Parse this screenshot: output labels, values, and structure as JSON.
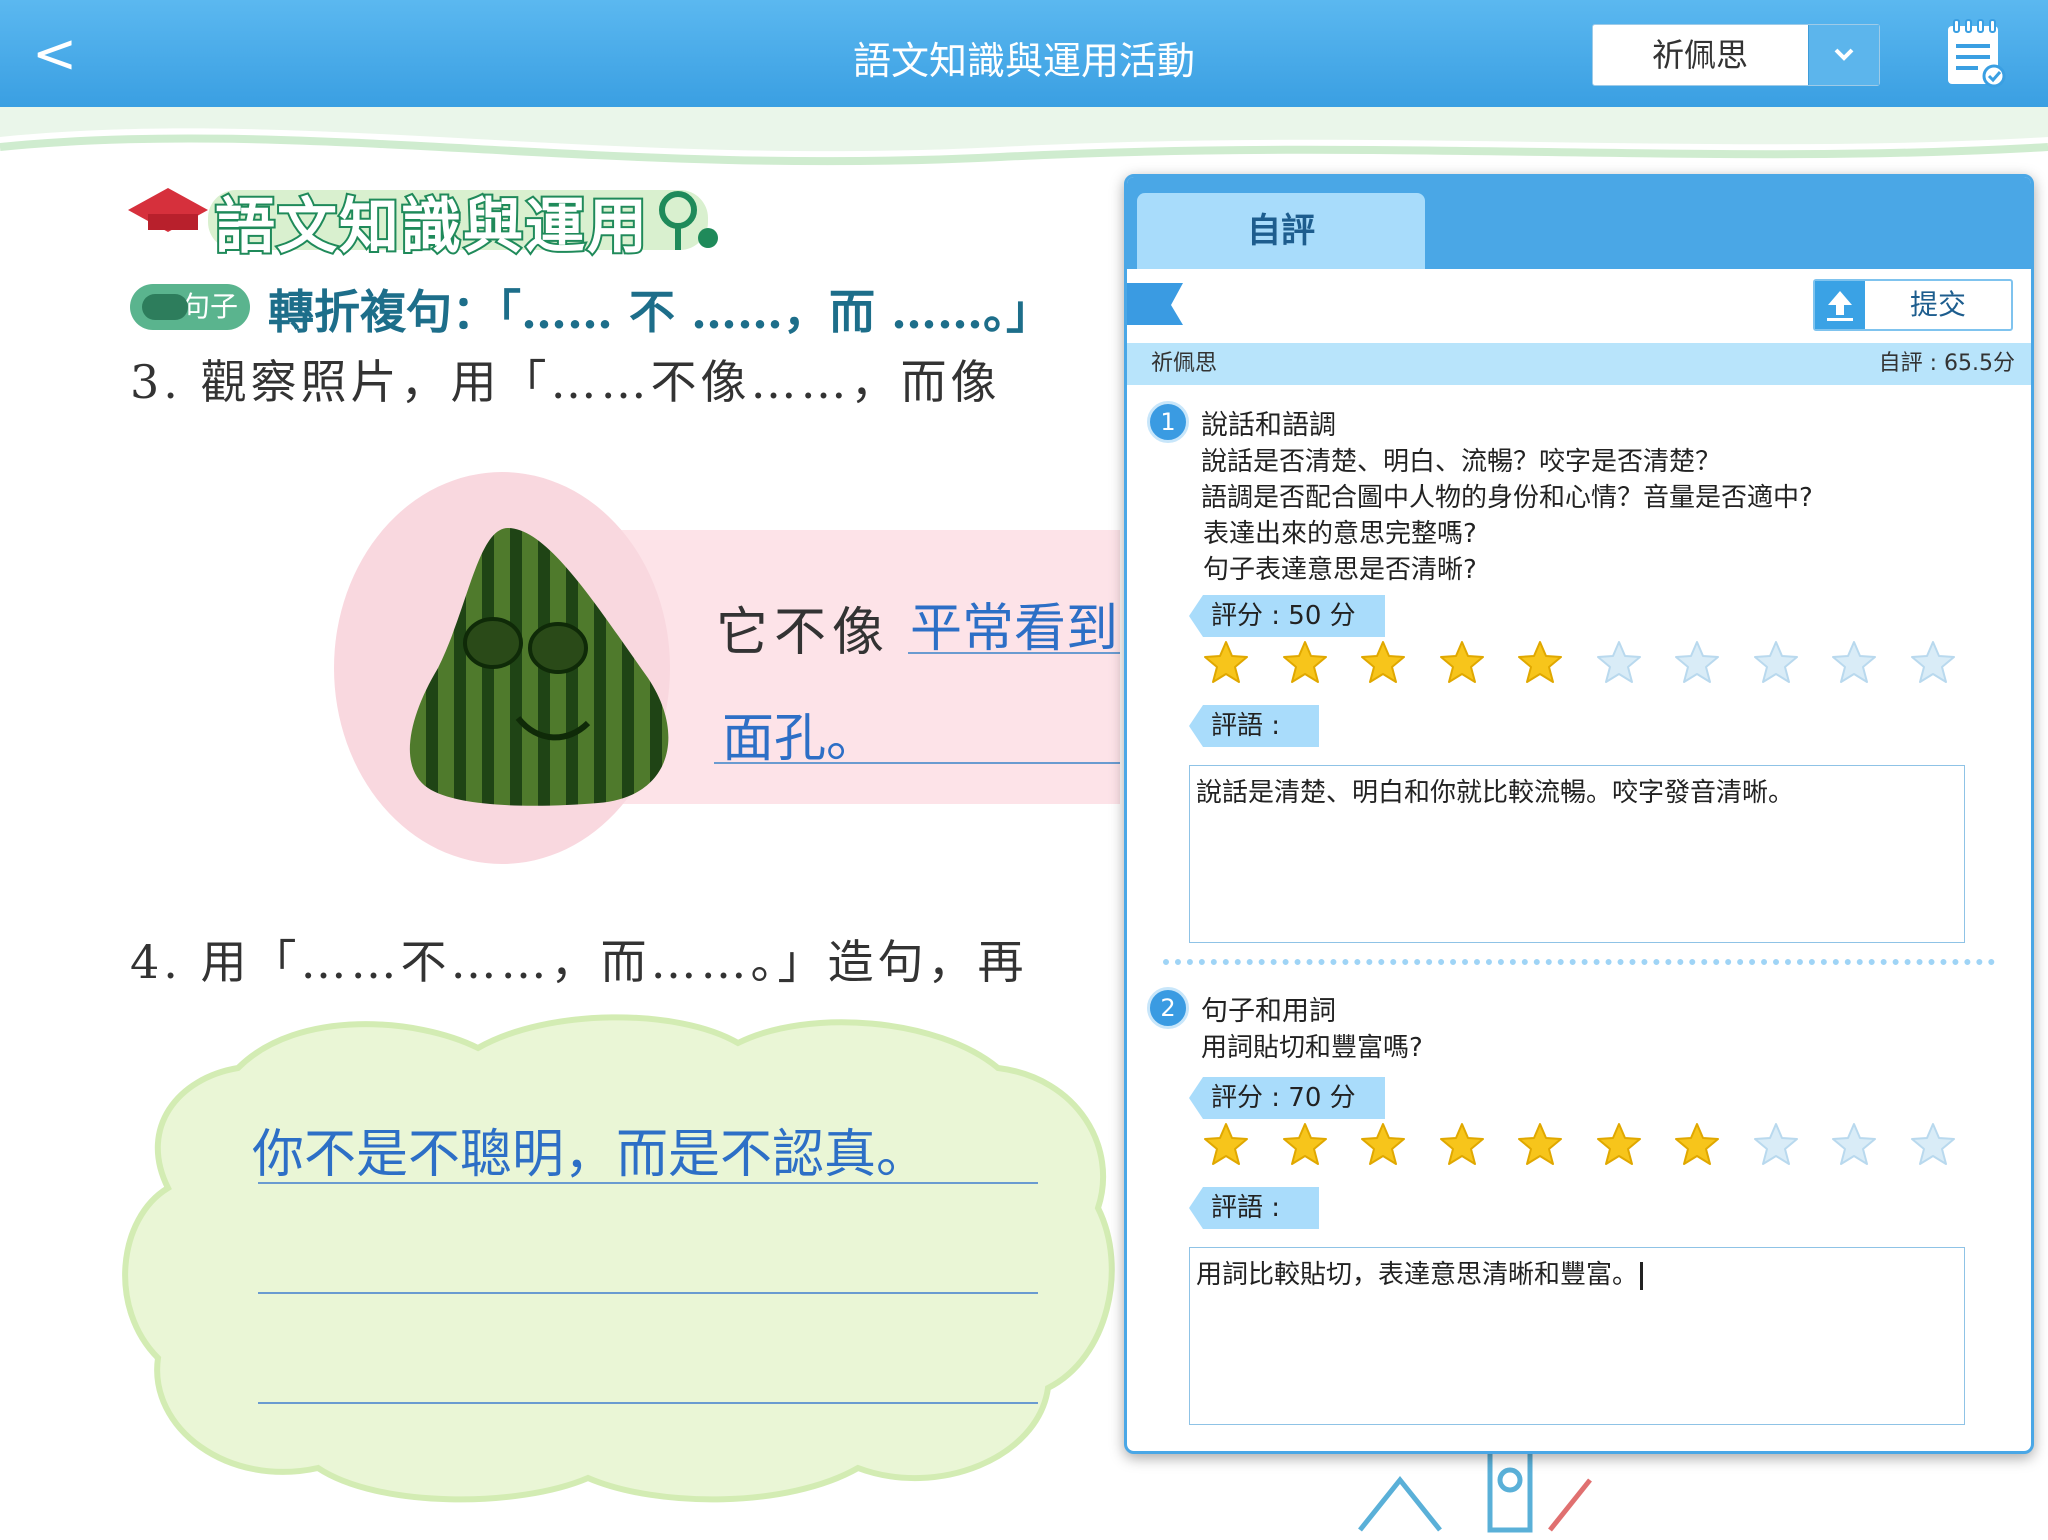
{
  "topbar": {
    "back_label": "<",
    "title": "語文知識與運用活動",
    "student_select": {
      "selected": "祈佩思",
      "arrow": "⌄"
    },
    "notepad_icon": "notepad-check-icon"
  },
  "textbook": {
    "heading": "語文知識與運用",
    "tag": "句子",
    "sub_heading": "轉折複句：「…… 不 ……，而 ……。」",
    "q3": "3. 觀察照片，用「……不像……，而像",
    "q3_answer_prefix": "它不像",
    "q3_answer_line1": "平常看到",
    "q3_answer_line2": "面孔",
    "q3_answer_end": "。",
    "q4": "4. 用「……不……，而……。」造句，再",
    "q4_answer": "你不是不聰明，而是不認真。"
  },
  "panel": {
    "tab_label": "自評",
    "submit_label": "提交",
    "student_name": "祈佩思",
    "total_score": "自評 : 65.5分",
    "criteria": [
      {
        "number": "1",
        "title": "說話和語調",
        "questions": [
          "說話是否清楚、明白、流暢？咬字是否清楚？",
          "語調是否配合圖中人物的身份和心情？音量是否適中?",
          "表達出來的意思完整嗎?",
          "句子表達意思是否清晰?"
        ],
        "score_label": "評分 : 50 分",
        "stars_filled": 5,
        "stars_total": 10,
        "comment_label": "評語 :",
        "comment": "說話是清楚、明白和你就比較流暢。咬字發音清晰。"
      },
      {
        "number": "2",
        "title": "句子和用詞",
        "questions": [
          "用詞貼切和豐富嗎?"
        ],
        "score_label": "評分 : 70 分",
        "stars_filled": 7,
        "stars_total": 10,
        "comment_label": "評語 :",
        "comment": "用詞比較貼切，表達意思清晰和豐富。"
      }
    ]
  },
  "colors": {
    "topbar": "#3a9fe2",
    "panel_accent": "#4aa7e6",
    "star_filled": "#f7c51b",
    "star_empty": "#d9ecf7",
    "answer_blue": "#2d6fc6"
  }
}
